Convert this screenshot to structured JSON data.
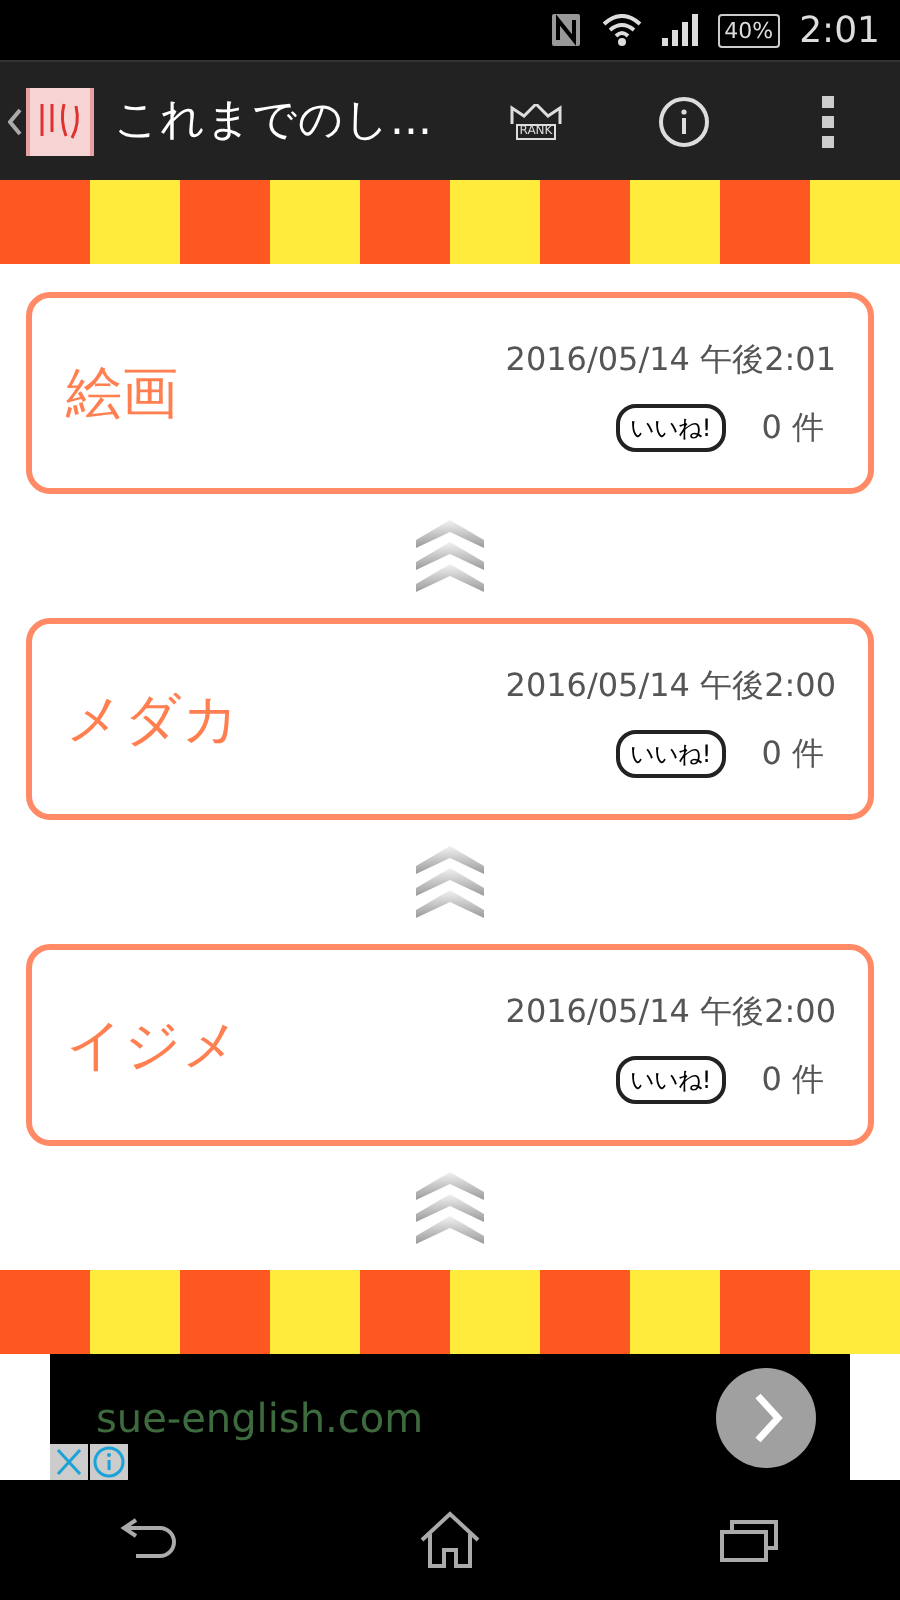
{
  "status_bar": {
    "battery": "40%",
    "time": "2:01"
  },
  "action_bar": {
    "title": "これまでのし...",
    "rank_label": "RANK"
  },
  "entries": [
    {
      "word": "絵画",
      "date": "2016/05/14 午後2:01",
      "like_label": "いいね!",
      "count": "0 件"
    },
    {
      "word": "メダカ",
      "date": "2016/05/14 午後2:00",
      "like_label": "いいね!",
      "count": "0 件"
    },
    {
      "word": "イジメ",
      "date": "2016/05/14 午後2:00",
      "like_label": "いいね!",
      "count": "0 件"
    }
  ],
  "ad": {
    "url": "sue-english.com"
  }
}
